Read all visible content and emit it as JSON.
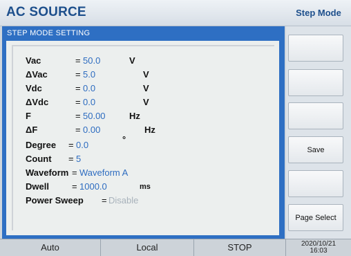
{
  "header": {
    "title": "AC SOURCE",
    "mode": "Step Mode"
  },
  "panel": {
    "title": "STEP MODE SETTING"
  },
  "fields": {
    "vac": {
      "label": "Vac",
      "eq": "=",
      "value": "50.0",
      "unit": "V"
    },
    "dvac": {
      "label": "ΔVac",
      "eq": "=",
      "value": "5.0",
      "unit": "V"
    },
    "vdc": {
      "label": "Vdc",
      "eq": "=",
      "value": "0.0",
      "unit": "V"
    },
    "dvdc": {
      "label": "ΔVdc",
      "eq": "=",
      "value": "0.0",
      "unit": "V"
    },
    "f": {
      "label": "F",
      "eq": "=",
      "value": "50.00",
      "unit": "Hz"
    },
    "df": {
      "label": "ΔF",
      "eq": "=",
      "value": "0.00",
      "unit": "Hz"
    },
    "degree": {
      "label": "Degree",
      "eq": "=",
      "value": "0.0",
      "unit": "°"
    },
    "count": {
      "label": "Count",
      "eq": "=",
      "value": "5"
    },
    "waveform": {
      "label": "Waveform",
      "eq": "=",
      "value": "Waveform A"
    },
    "dwell": {
      "label": "Dwell",
      "eq": "=",
      "value": "1000.0",
      "unit": "ms"
    },
    "power_sweep": {
      "label": "Power Sweep",
      "eq": "=",
      "value": "Disable"
    }
  },
  "softkeys": [
    "",
    "",
    "",
    "Save",
    "",
    "Page Select"
  ],
  "status": {
    "auto": "Auto",
    "local": "Local",
    "stop": "STOP",
    "date": "2020/10/21",
    "time": "16:03"
  }
}
